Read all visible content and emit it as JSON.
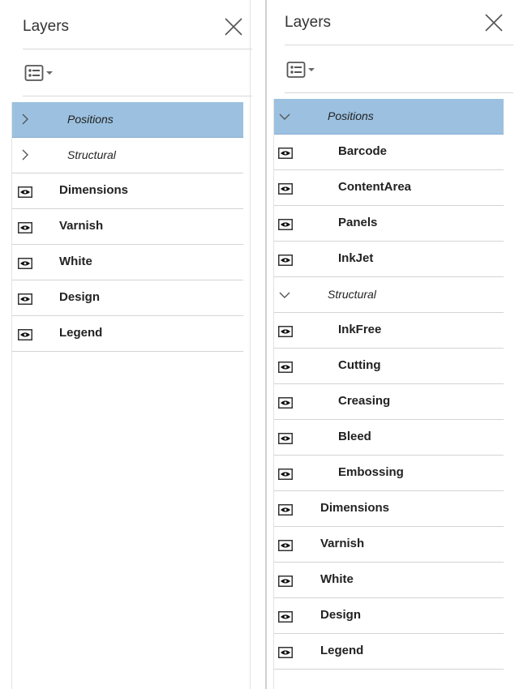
{
  "left_panel": {
    "title": "Layers",
    "rows": [
      {
        "label": "Positions",
        "type": "group",
        "expanded": false,
        "selected": true
      },
      {
        "label": "Structural",
        "type": "group",
        "expanded": false,
        "selected": false
      },
      {
        "label": "Dimensions",
        "type": "layer",
        "visible": true
      },
      {
        "label": "Varnish",
        "type": "layer",
        "visible": true
      },
      {
        "label": "White",
        "type": "layer",
        "visible": true
      },
      {
        "label": "Design",
        "type": "layer",
        "visible": true
      },
      {
        "label": "Legend",
        "type": "layer",
        "visible": true
      }
    ]
  },
  "right_panel": {
    "title": "Layers",
    "rows": [
      {
        "label": "Positions",
        "type": "group",
        "expanded": true,
        "selected": true
      },
      {
        "label": "Barcode",
        "type": "child",
        "visible": true
      },
      {
        "label": "ContentArea",
        "type": "child",
        "visible": true
      },
      {
        "label": "Panels",
        "type": "child",
        "visible": true
      },
      {
        "label": "InkJet",
        "type": "child",
        "visible": true
      },
      {
        "label": "Structural",
        "type": "group",
        "expanded": true,
        "selected": false
      },
      {
        "label": "InkFree",
        "type": "child",
        "visible": true
      },
      {
        "label": "Cutting",
        "type": "child",
        "visible": true
      },
      {
        "label": "Creasing",
        "type": "child",
        "visible": true
      },
      {
        "label": "Bleed",
        "type": "child",
        "visible": true
      },
      {
        "label": "Embossing",
        "type": "child",
        "visible": true
      },
      {
        "label": "Dimensions",
        "type": "layer",
        "visible": true
      },
      {
        "label": "Varnish",
        "type": "layer",
        "visible": true
      },
      {
        "label": "White",
        "type": "layer",
        "visible": true
      },
      {
        "label": "Design",
        "type": "layer",
        "visible": true
      },
      {
        "label": "Legend",
        "type": "layer",
        "visible": true
      }
    ]
  },
  "icons": {
    "close": "close-icon",
    "view_menu": "list-view-menu-icon",
    "collapsed": "chevron-right-icon",
    "expanded": "chevron-down-icon",
    "visibility": "eye-icon"
  },
  "colors": {
    "selected_row": "#9cc1e0",
    "divider": "#d4d4d4"
  }
}
